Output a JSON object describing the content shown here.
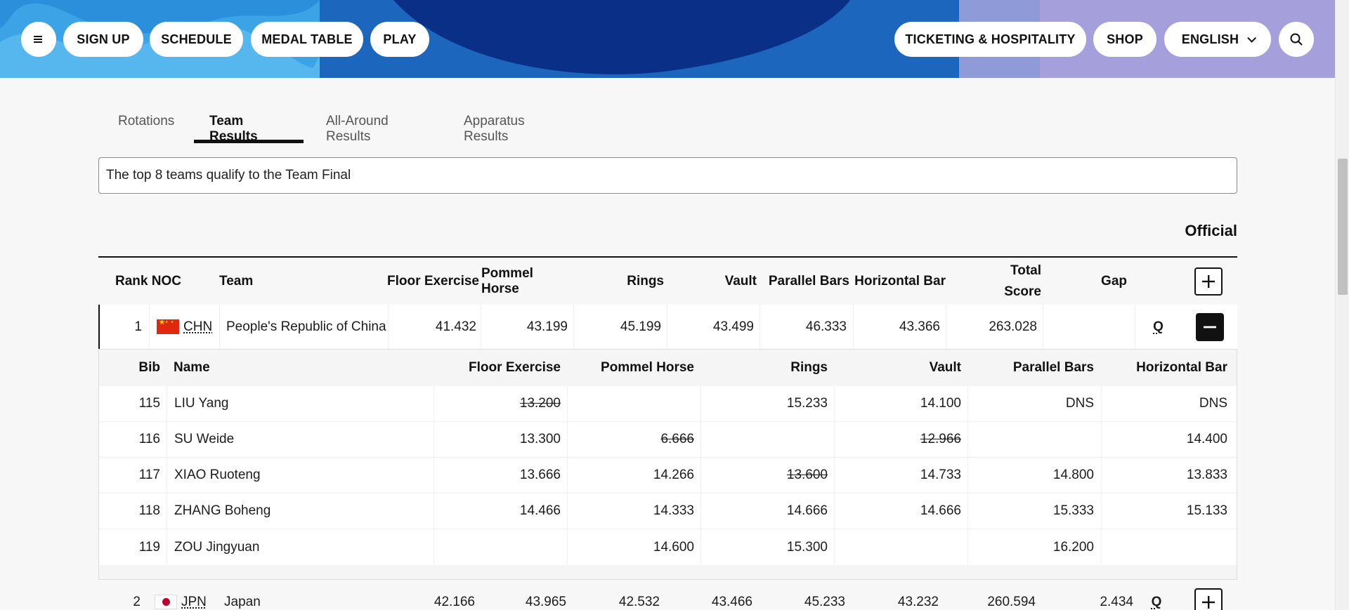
{
  "nav": {
    "menu_icon": "hamburger-icon",
    "sign_up": "SIGN UP",
    "schedule": "SCHEDULE",
    "medal_table": "MEDAL TABLE",
    "play": "PLAY",
    "ticketing": "TICKETING & HOSPITALITY",
    "shop": "SHOP",
    "language": "ENGLISH",
    "search_icon": "search-icon"
  },
  "tabs": [
    {
      "label": "Rotations",
      "active": false
    },
    {
      "label": "Team Results",
      "active": true
    },
    {
      "label": "All-Around Results",
      "active": false
    },
    {
      "label": "Apparatus Results",
      "active": false
    }
  ],
  "info_text": "The top 8 teams qualify to the Team Final",
  "status": "Official",
  "team_header": {
    "rank_noc": "Rank NOC",
    "team": "Team",
    "floor": "Floor Exercise",
    "pommel": "Pommel Horse",
    "rings": "Rings",
    "vault": "Vault",
    "pbars": "Parallel Bars",
    "hbar": "Horizontal Bar",
    "total_1": "Total",
    "total_2": "Score",
    "gap": "Gap"
  },
  "teams": [
    {
      "rank": "1",
      "noc": "CHN",
      "team": "People's Republic of China",
      "floor": "41.432",
      "pommel": "43.199",
      "rings": "45.199",
      "vault": "43.499",
      "pbars": "46.333",
      "hbar": "43.366",
      "total": "263.028",
      "gap": "",
      "q": "Q",
      "expanded": true
    },
    {
      "rank": "2",
      "noc": "JPN",
      "team": "Japan",
      "floor": "42.166",
      "pommel": "43.965",
      "rings": "42.532",
      "vault": "43.466",
      "pbars": "45.233",
      "hbar": "43.232",
      "total": "260.594",
      "gap": "2.434",
      "q": "Q",
      "expanded": false
    }
  ],
  "athlete_header": {
    "bib": "Bib",
    "name": "Name",
    "floor": "Floor Exercise",
    "pommel": "Pommel Horse",
    "rings": "Rings",
    "vault": "Vault",
    "pbars": "Parallel Bars",
    "hbar": "Horizontal Bar"
  },
  "athletes": [
    {
      "bib": "115",
      "name": "LIU Yang",
      "floor": "13.200",
      "pommel": "",
      "rings": "15.233",
      "vault": "14.100",
      "pbars": "DNS",
      "hbar": "DNS"
    },
    {
      "bib": "116",
      "name": "SU Weide",
      "floor": "13.300",
      "pommel": "6.666",
      "rings": "",
      "vault": "12.966",
      "pbars": "",
      "hbar": "14.400"
    },
    {
      "bib": "117",
      "name": "XIAO Ruoteng",
      "floor": "13.666",
      "pommel": "14.266",
      "rings": "13.600",
      "vault": "14.733",
      "pbars": "14.800",
      "hbar": "13.833"
    },
    {
      "bib": "118",
      "name": "ZHANG Boheng",
      "floor": "14.466",
      "pommel": "14.333",
      "rings": "14.666",
      "vault": "14.666",
      "pbars": "15.333",
      "hbar": "15.133"
    },
    {
      "bib": "119",
      "name": "ZOU Jingyuan",
      "floor": "",
      "pommel": "14.600",
      "rings": "15.300",
      "vault": "",
      "pbars": "16.200",
      "hbar": ""
    }
  ],
  "colors": {
    "banner_blue": "#1d6ec2",
    "banner_dark": "#0a2f86",
    "banner_light": "#43a6e6",
    "banner_lavender": "#a59fdc"
  }
}
